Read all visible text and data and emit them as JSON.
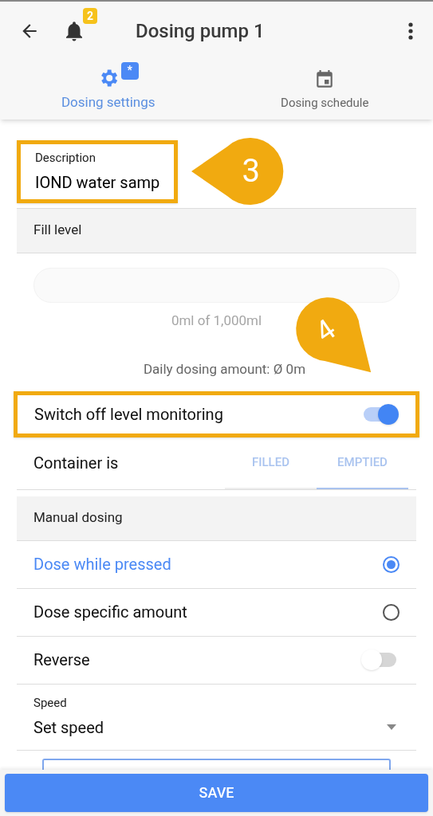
{
  "app_bar": {
    "title": "Dosing pump 1",
    "notification_count": "2"
  },
  "tabs": [
    {
      "label": "Dosing settings",
      "badge": "*",
      "selected": true
    },
    {
      "label": "Dosing schedule",
      "selected": false
    }
  ],
  "description": {
    "label": "Description",
    "value": "IOND water samp",
    "highlighted": true
  },
  "fill_level": {
    "header": "Fill level",
    "level": 0,
    "reading": "0ml of 1,000ml",
    "daily": "Daily dosing amount: Ø 0m"
  },
  "level_monitoring": {
    "label": "Switch off level monitoring",
    "on": true,
    "highlighted": true
  },
  "container": {
    "label": "Container is",
    "options": [
      {
        "label": "FILLED",
        "selected": false
      },
      {
        "label": "EMPTIED",
        "selected": true
      }
    ]
  },
  "manual_dosing": {
    "header": "Manual dosing",
    "modes": [
      {
        "label": "Dose while pressed",
        "selected": true
      },
      {
        "label": "Dose specific amount",
        "selected": false
      }
    ],
    "reverse": {
      "label": "Reverse",
      "on": false
    },
    "speed": {
      "label": "Speed",
      "value": "Set speed"
    }
  },
  "save_button": "SAVE",
  "callouts": [
    {
      "number": "3"
    },
    {
      "number": "4"
    }
  ]
}
